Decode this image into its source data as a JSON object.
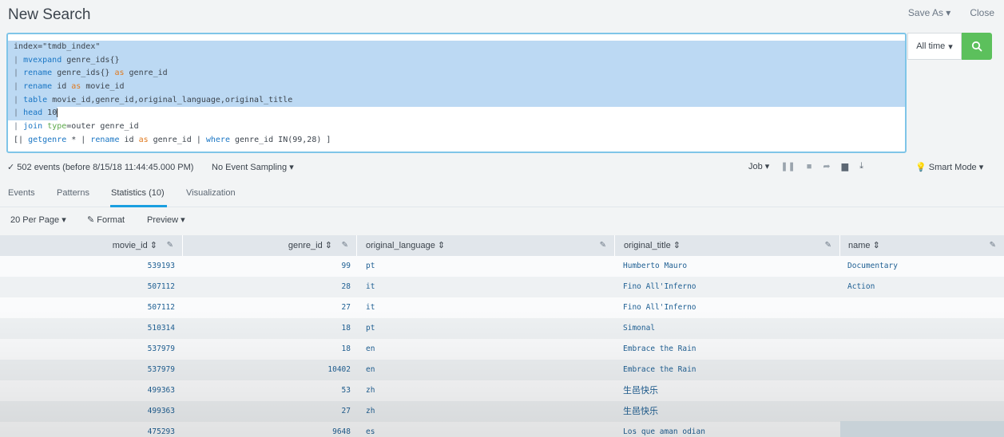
{
  "page": {
    "title": "New Search",
    "save_as": "Save As",
    "close": "Close"
  },
  "search": {
    "lines": [
      "index=\"tmdb_index\"",
      "| mvexpand genre_ids{}",
      "| rename genre_ids{} as genre_id",
      "| rename id as movie_id",
      "| table movie_id,genre_id,original_language,original_title",
      "| head 10",
      "| join type=outer genre_id",
      "[| getgenre * | rename id as genre_id | where genre_id IN(99,28) ]"
    ],
    "time_range": "All time",
    "submit_icon": "search-icon"
  },
  "status": {
    "events": "502 events (before 8/15/18 11:44:45.000 PM)",
    "sampling": "No Event Sampling",
    "job": "Job",
    "mode": "Smart Mode"
  },
  "tabs": [
    "Events",
    "Patterns",
    "Statistics (10)",
    "Visualization"
  ],
  "controls": {
    "per_page": "20 Per Page",
    "format": "Format",
    "preview": "Preview"
  },
  "table": {
    "columns": [
      "movie_id",
      "genre_id",
      "original_language",
      "original_title",
      "name"
    ],
    "rows": [
      [
        "539193",
        "99",
        "pt",
        "Humberto Mauro",
        "Documentary"
      ],
      [
        "507112",
        "28",
        "it",
        "Fino All'Inferno",
        "Action"
      ],
      [
        "507112",
        "27",
        "it",
        "Fino All'Inferno",
        ""
      ],
      [
        "510314",
        "18",
        "pt",
        "Simonal",
        ""
      ],
      [
        "537979",
        "18",
        "en",
        "Embrace the Rain",
        ""
      ],
      [
        "537979",
        "10402",
        "en",
        "Embrace the Rain",
        ""
      ],
      [
        "499363",
        "53",
        "zh",
        "生邑快乐",
        ""
      ],
      [
        "499363",
        "27",
        "zh",
        "生邑快乐",
        ""
      ],
      [
        "475293",
        "9648",
        "es",
        "Los que aman odian",
        ""
      ]
    ]
  }
}
